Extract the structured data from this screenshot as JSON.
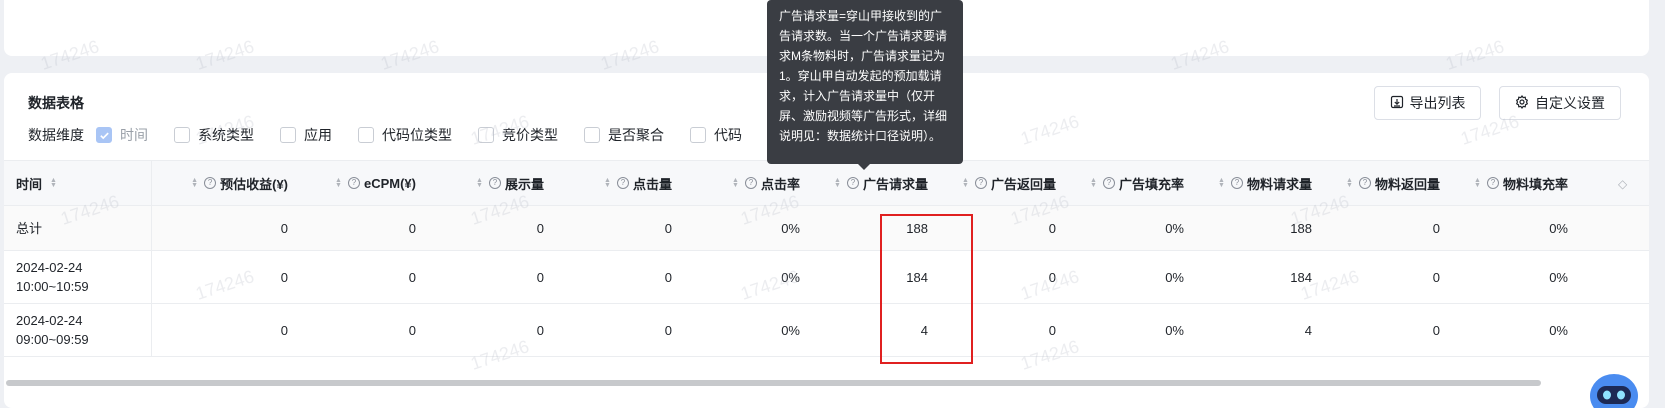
{
  "section": {
    "title": "数据表格"
  },
  "toolbar": {
    "export_label": "导出列表",
    "custom_label": "自定义设置"
  },
  "dims": {
    "label": "数据维度",
    "items": [
      {
        "label": "时间",
        "checked": true
      },
      {
        "label": "系统类型",
        "checked": false
      },
      {
        "label": "应用",
        "checked": false
      },
      {
        "label": "代码位类型",
        "checked": false
      },
      {
        "label": "竞价类型",
        "checked": false
      },
      {
        "label": "是否聚合",
        "checked": false
      },
      {
        "label": "代码",
        "checked": false
      }
    ]
  },
  "table": {
    "headers": [
      "时间",
      "预估收益(¥)",
      "eCPM(¥)",
      "展示量",
      "点击量",
      "点击率",
      "广告请求量",
      "广告返回量",
      "广告填充率",
      "物料请求量",
      "物料返回量",
      "物料填充率"
    ],
    "rows": [
      {
        "time": "总计",
        "values": [
          "0",
          "0",
          "0",
          "0",
          "0%",
          "188",
          "0",
          "0%",
          "188",
          "0",
          "0%"
        ]
      },
      {
        "time": "2024-02-24\n10:00~10:59",
        "values": [
          "0",
          "0",
          "0",
          "0",
          "0%",
          "184",
          "0",
          "0%",
          "184",
          "0",
          "0%"
        ]
      },
      {
        "time": "2024-02-24\n09:00~09:59",
        "values": [
          "0",
          "0",
          "0",
          "0",
          "0%",
          "4",
          "0",
          "0%",
          "4",
          "0",
          "0%"
        ]
      }
    ]
  },
  "tooltip": {
    "text": "广告请求量=穿山甲接收到的广告请求数。当一个广告请求要请求M条物料时，广告请求量记为1。穿山甲自动发起的预加载请求，计入广告请求量中（仅开屏、激励视频等广告形式，详细说明见：数据统计口径说明）。"
  },
  "watermark": "174246",
  "colors": {
    "highlight": "#e02020",
    "tooltip_bg": "#3a3d43",
    "checkbox_checked": "#a9c5f5"
  }
}
